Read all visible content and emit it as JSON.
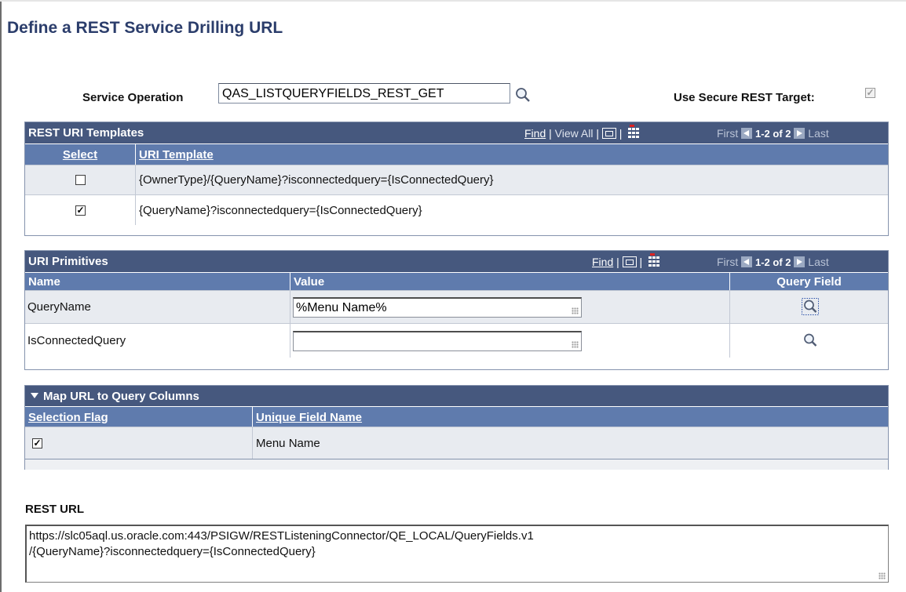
{
  "page": {
    "title": "Define a REST Service Drilling URL"
  },
  "service": {
    "label": "Service Operation",
    "value": "QAS_LISTQUERYFIELDS_REST_GET",
    "lookup_icon": "search-icon"
  },
  "secure": {
    "label": "Use Secure REST Target:",
    "checked": true,
    "check_mark": "✓"
  },
  "uri_templates": {
    "title": "REST URI Templates",
    "nav": {
      "find": "Find",
      "separator": "|",
      "view_all": "View All",
      "first": "First",
      "count": "1-2 of 2",
      "last": "Last"
    },
    "columns": [
      "Select",
      "URI Template"
    ],
    "rows": [
      {
        "checked": false,
        "mark": "",
        "template": "{OwnerType}/{QueryName}?isconnectedquery={IsConnectedQuery}"
      },
      {
        "checked": true,
        "mark": "✓",
        "template": "{QueryName}?isconnectedquery={IsConnectedQuery}"
      }
    ]
  },
  "uri_primitives": {
    "title": "URI Primitives",
    "nav": {
      "find": "Find",
      "separator": "|",
      "first": "First",
      "count": "1-2 of 2",
      "last": "Last"
    },
    "columns": [
      "Name",
      "Value",
      "Query Field"
    ],
    "rows": [
      {
        "name": "QueryName",
        "value": "%Menu Name%"
      },
      {
        "name": "IsConnectedQuery",
        "value": ""
      }
    ]
  },
  "map_columns": {
    "title": "Map URL to Query Columns",
    "columns": [
      "Selection Flag",
      "Unique Field Name"
    ],
    "rows": [
      {
        "checked": true,
        "mark": "✓",
        "field": "Menu Name"
      }
    ]
  },
  "rest_url": {
    "label": "REST URL",
    "line1": "https://slc05aql.us.oracle.com:443/PSIGW/RESTListeningConnector/QE_LOCAL/QueryFields.v1",
    "line2": "/{QueryName}?isconnectedquery={IsConnectedQuery}"
  },
  "colors": {
    "title": "#2b3d6b",
    "grid_header": "#46587e",
    "column_header": "#5f7bad",
    "row_alt": "#e8ebf0"
  }
}
